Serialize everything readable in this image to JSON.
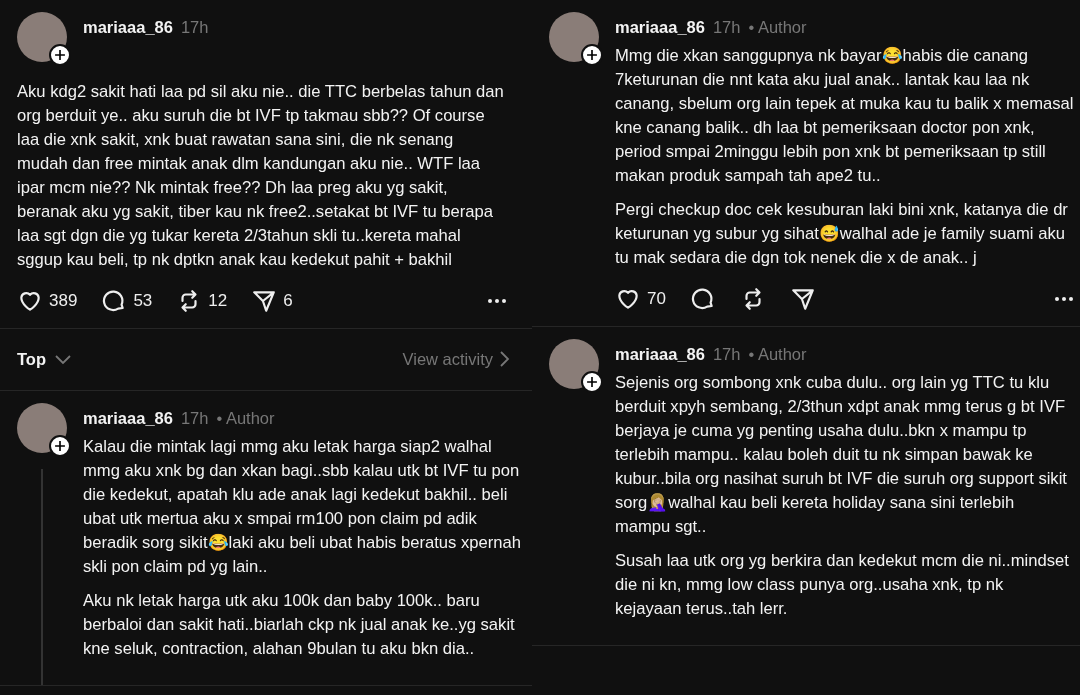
{
  "columns": [
    {
      "items": [
        {
          "kind": "post",
          "username": "mariaaa_86",
          "time": "17h",
          "body_indented": false,
          "thread_line": false,
          "paragraphs": [
            "Aku kdg2 sakit hati laa pd sil aku nie.. die TTC berbelas tahun dan org berduit ye.. aku suruh die bt IVF tp takmau sbb?? Of course laa die xnk sakit, xnk buat rawatan sana sini, die nk senang mudah dan free mintak anak dlm kandungan aku nie.. WTF laa ipar mcm nie?? Nk mintak free?? Dh laa preg aku yg sakit, beranak aku yg sakit, tiber kau nk free2..setakat bt IVF tu berapa laa sgt dgn die yg tukar kereta 2/3tahun skli tu..kereta mahal sggup kau beli, tp nk dptkn anak kau kedekut pahit + bakhil"
          ],
          "actions": [
            {
              "kind": "like",
              "count": "389"
            },
            {
              "kind": "reply",
              "count": "53"
            },
            {
              "kind": "repost",
              "count": "12"
            },
            {
              "kind": "share",
              "count": "6"
            }
          ]
        },
        {
          "kind": "sort_bar",
          "sort_label": "Top",
          "activity_label": "View activity"
        },
        {
          "kind": "post",
          "username": "mariaaa_86",
          "time": "17h",
          "author_label": "• Author",
          "body_indented": true,
          "thread_line": true,
          "paragraphs": [
            "Kalau die mintak lagi mmg aku letak harga siap2 walhal mmg aku xnk bg dan xkan bagi..sbb kalau utk bt IVF tu pon die kedekut, apatah klu ade anak lagi kedekut bakhil.. beli ubat utk mertua aku x smpai rm100 pon claim pd adik beradik sorg sikit😂laki aku beli ubat habis beratus xpernah skli pon claim pd yg lain..",
            "Aku nk letak harga utk aku 100k dan baby 100k.. baru berbaloi dan sakit hati..biarlah ckp nk jual anak ke..yg sakit kne seluk, contraction, alahan 9bulan tu aku bkn dia.."
          ]
        }
      ]
    },
    {
      "items": [
        {
          "kind": "post",
          "username": "mariaaa_86",
          "time": "17h",
          "author_label": "• Author",
          "body_indented": true,
          "thread_line": false,
          "paragraphs": [
            "Mmg die xkan sanggupnya nk bayar😂habis die canang 7keturunan die nnt kata aku jual anak.. lantak kau laa nk canang, sbelum org lain tepek at muka kau tu balik x memasal kne canang balik.. dh laa bt pemeriksaan doctor pon xnk, period smpai 2minggu lebih pon xnk bt pemeriksaan tp still makan produk sampah tah ape2 tu..",
            "Pergi checkup doc cek kesuburan laki bini xnk, katanya die dr keturunan yg subur yg sihat😅walhal ade je family suami aku tu mak sedara die dgn tok nenek die x de anak.. j"
          ],
          "actions": [
            {
              "kind": "like",
              "count": "70"
            },
            {
              "kind": "reply"
            },
            {
              "kind": "repost"
            },
            {
              "kind": "share"
            }
          ]
        },
        {
          "kind": "post",
          "username": "mariaaa_86",
          "time": "17h",
          "author_label": "• Author",
          "body_indented": true,
          "thread_line": false,
          "paragraphs": [
            "Sejenis org sombong xnk cuba dulu.. org lain yg TTC tu klu berduit xpyh sembang, 2/3thun xdpt anak mmg terus g bt IVF berjaya je cuma yg penting usaha dulu..bkn x mampu tp terlebih mampu.. kalau boleh duit tu nk simpan bawak ke kubur..bila org nasihat suruh bt IVF die suruh org support sikit sorg🤦🏼‍♀️walhal kau beli kereta holiday sana sini terlebih mampu sgt..",
            "Susah laa utk org yg berkira dan kedekut mcm die ni..mindset die ni kn, mmg low class punya org..usaha xnk, tp nk kejayaan terus..tah lerr."
          ]
        }
      ]
    }
  ]
}
